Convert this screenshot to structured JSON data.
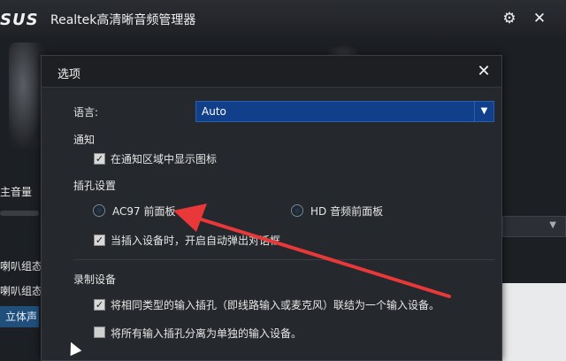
{
  "app": {
    "logo_text": "SUS",
    "title": "Realtek高清晰音频管理器",
    "settings_icon": "gear-icon",
    "close_icon": "close-icon"
  },
  "background": {
    "volume_label": "主音量",
    "speaker_config_label_1": "喇叭组态",
    "speaker_config_label_2": "喇叭组态",
    "stereo_tab": "立体声"
  },
  "dialog": {
    "title": "选项",
    "close_icon": "close-icon",
    "language": {
      "label": "语言:",
      "selected": "Auto"
    },
    "notification": {
      "section": "通知",
      "show_tray_icon": {
        "label": "在通知区域中显示图标",
        "checked": true
      }
    },
    "jack_settings": {
      "section": "插孔设置",
      "options": [
        {
          "label": "AC97 前面板",
          "selected": false
        },
        {
          "label": "HD 音频前面板",
          "selected": false
        }
      ],
      "popup_dialog": {
        "label": "当插入设备时，开启自动弹出对话框",
        "checked": true
      }
    },
    "recording": {
      "section": "录制设备",
      "link_same_type": {
        "label": "将相同类型的输入插孔（即线路输入或麦克风）联结为一个输入设备。",
        "checked": true
      },
      "separate_all": {
        "label": "将所有输入插孔分离为单独的输入设备。",
        "checked": false
      }
    }
  },
  "colors": {
    "select_bg": "#123f8a",
    "annotation_arrow": "#e8383a"
  }
}
